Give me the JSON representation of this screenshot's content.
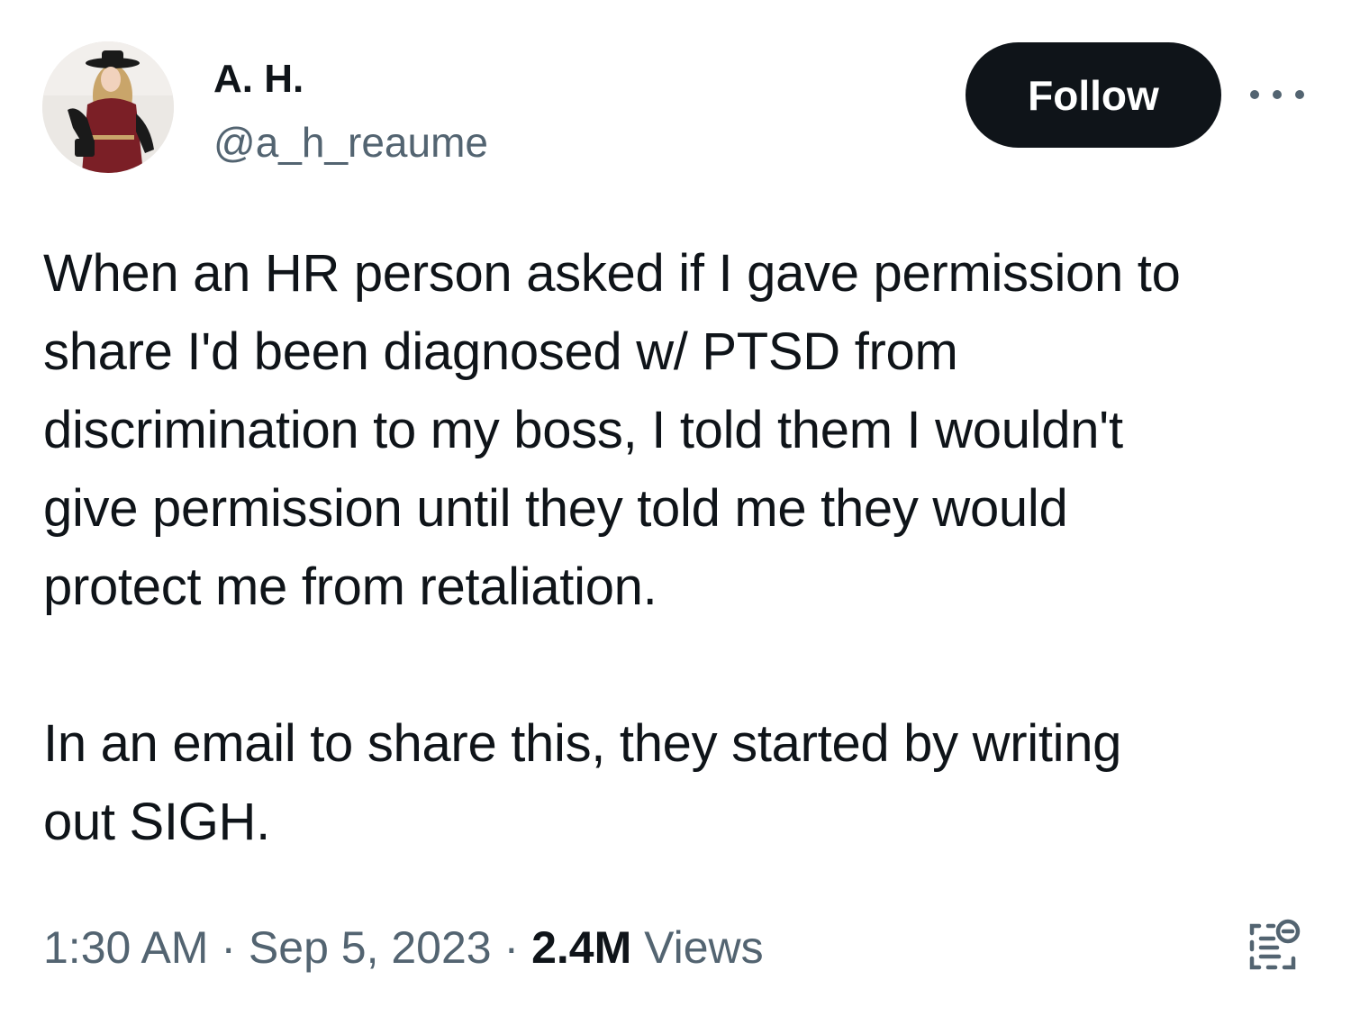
{
  "tweet": {
    "author": {
      "display_name": "A. H.",
      "handle": "@a_h_reaume",
      "avatar_icon": "profile-photo"
    },
    "follow_label": "Follow",
    "more_icon": "more-horizontal-icon",
    "paragraphs": [
      "When an HR person asked if I gave permission to\nshare I'd been diagnosed w/ PTSD from\ndiscrimination to my boss, I told them I wouldn't\ngive permission until they told me they would\nprotect me from retaliation.",
      "In an email to share this, they started by writing\nout SIGH."
    ],
    "time": "1:30 AM",
    "separator": "·",
    "date": "Sep 5, 2023",
    "views_count": "2.4M",
    "views_label": "Views",
    "analytics_icon": "analytics-icon"
  },
  "colors": {
    "text_primary": "#0f1419",
    "text_secondary": "#536471",
    "follow_bg": "#0f1419",
    "follow_text": "#ffffff",
    "background": "#ffffff"
  }
}
